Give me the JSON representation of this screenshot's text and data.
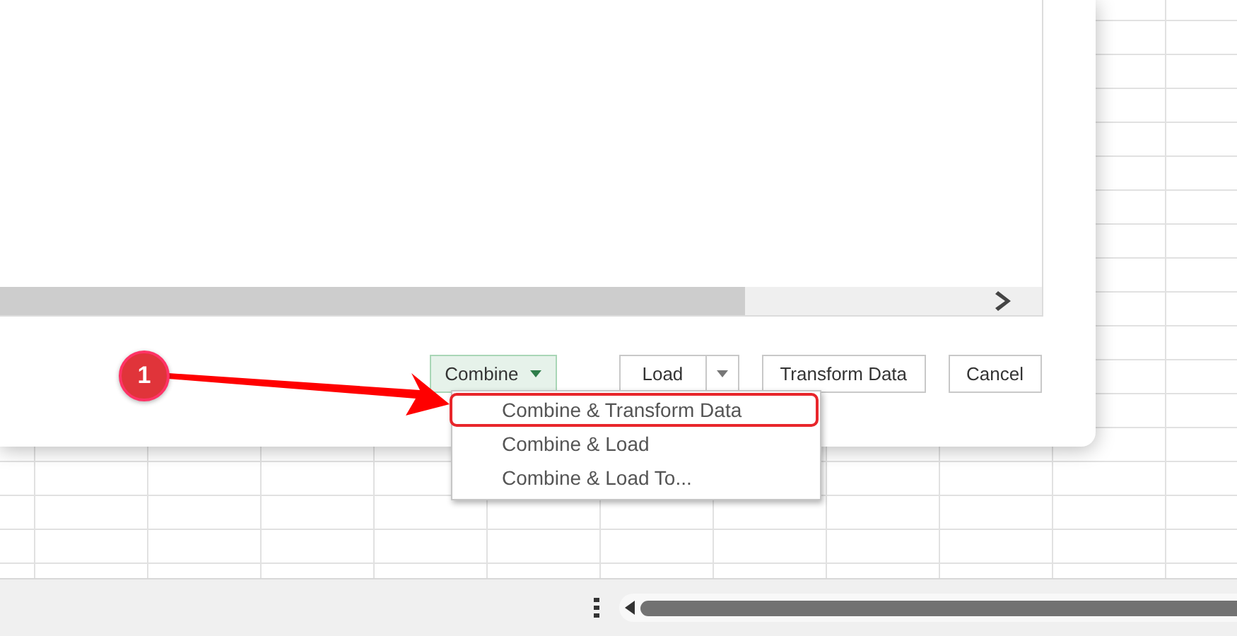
{
  "dialog": {
    "buttons": [
      {
        "label": "Combine",
        "kind": "dropdown",
        "selected": true
      },
      {
        "label": "Load",
        "kind": "split",
        "selected": false
      },
      {
        "label": "Transform Data",
        "kind": "plain",
        "selected": false
      },
      {
        "label": "Cancel",
        "kind": "plain",
        "selected": false
      }
    ]
  },
  "menu": {
    "items": [
      {
        "label": "Combine & Transform Data",
        "selected": true
      },
      {
        "label": "Combine & Load",
        "selected": false
      },
      {
        "label": "Combine & Load To...",
        "selected": false
      }
    ]
  },
  "annotation": {
    "label": "1"
  }
}
